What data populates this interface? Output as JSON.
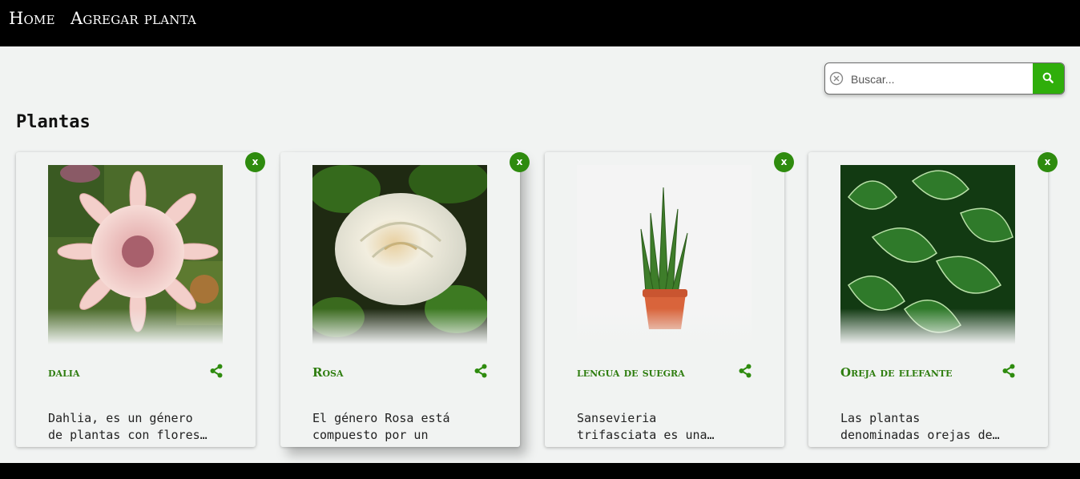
{
  "nav": {
    "home_label": "Home",
    "add_label": "Agregar planta"
  },
  "search": {
    "placeholder": "Buscar..."
  },
  "page": {
    "title": "Plantas"
  },
  "cards": [
    {
      "name": "dalia",
      "close_label": "x",
      "desc_line1": "Dahlia, es un género",
      "desc_line2": "de plantas con flores…"
    },
    {
      "name": "Rosa",
      "close_label": "x",
      "desc_line1": "El género Rosa está",
      "desc_line2": "compuesto por un"
    },
    {
      "name": "lengua de suegra",
      "close_label": "x",
      "desc_line1": "Sansevieria",
      "desc_line2": "trifasciata es una…"
    },
    {
      "name": "Oreja de elefante",
      "close_label": "x",
      "desc_line1": "Las plantas",
      "desc_line2": "denominadas orejas de…"
    }
  ],
  "colors": {
    "accent": "#2fae0b",
    "title_green": "#2e7d0f",
    "navbar": "#000000"
  },
  "icons": {
    "search": "search-icon",
    "clear": "clear-icon",
    "share": "share-icon"
  }
}
